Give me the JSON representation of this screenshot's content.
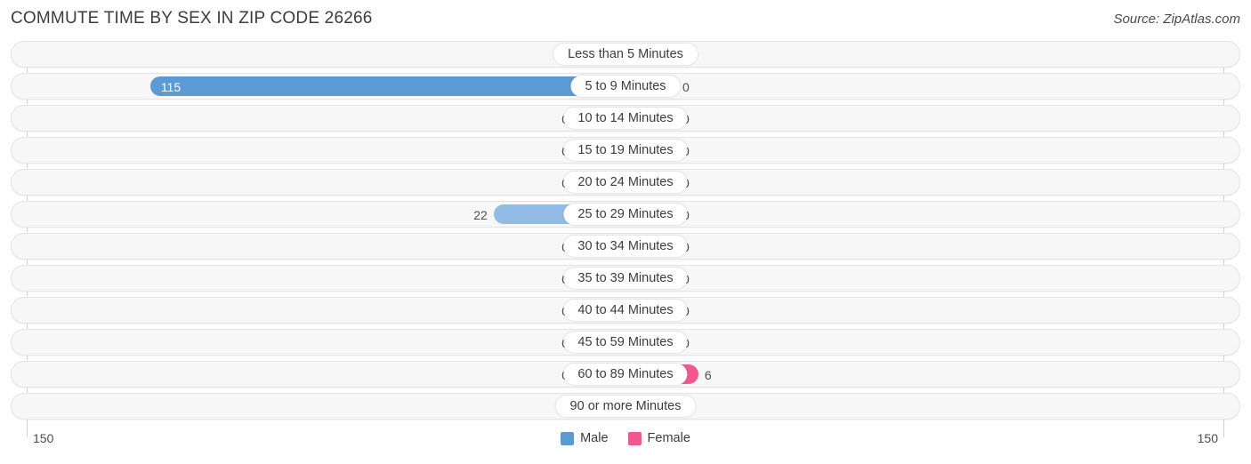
{
  "header": {
    "title": "COMMUTE TIME BY SEX IN ZIP CODE 26266",
    "source": "Source: ZipAtlas.com"
  },
  "axis": {
    "left_tick": "150",
    "right_tick": "150",
    "max": 150
  },
  "legend": {
    "male_label": "Male",
    "female_label": "Female",
    "male_color": "#5b9bd5",
    "female_color": "#f4568f"
  },
  "colors": {
    "male_zero": "#a8c8ea",
    "male_mid": "#92bce6",
    "male_strong": "#5b9bd5",
    "female_zero": "#f5a9c0",
    "female_strong": "#f4568f",
    "track": "#f7f7f7",
    "track_border": "#e4e4e4"
  },
  "chart_data": {
    "type": "bar",
    "title": "COMMUTE TIME BY SEX IN ZIP CODE 26266",
    "subtitle": "Source: ZipAtlas.com",
    "orientation": "horizontal-diverging",
    "xlabel": "",
    "ylabel": "",
    "xlim": [
      150,
      150
    ],
    "grid": false,
    "legend_position": "bottom-center",
    "categories": [
      "Less than 5 Minutes",
      "5 to 9 Minutes",
      "10 to 14 Minutes",
      "15 to 19 Minutes",
      "20 to 24 Minutes",
      "25 to 29 Minutes",
      "30 to 34 Minutes",
      "35 to 39 Minutes",
      "40 to 44 Minutes",
      "45 to 59 Minutes",
      "60 to 89 Minutes",
      "90 or more Minutes"
    ],
    "series": [
      {
        "name": "Male",
        "values": [
          0,
          115,
          0,
          0,
          0,
          22,
          0,
          0,
          0,
          0,
          0,
          0
        ]
      },
      {
        "name": "Female",
        "values": [
          0,
          0,
          0,
          0,
          0,
          0,
          0,
          0,
          0,
          0,
          6,
          0
        ]
      }
    ]
  },
  "rows": [
    {
      "label": "Less than 5 Minutes",
      "male": "0",
      "female": "0",
      "male_inside": false,
      "female_inside": false
    },
    {
      "label": "5 to 9 Minutes",
      "male": "115",
      "female": "0",
      "male_inside": true,
      "female_inside": false
    },
    {
      "label": "10 to 14 Minutes",
      "male": "0",
      "female": "0",
      "male_inside": false,
      "female_inside": false
    },
    {
      "label": "15 to 19 Minutes",
      "male": "0",
      "female": "0",
      "male_inside": false,
      "female_inside": false
    },
    {
      "label": "20 to 24 Minutes",
      "male": "0",
      "female": "0",
      "male_inside": false,
      "female_inside": false
    },
    {
      "label": "25 to 29 Minutes",
      "male": "22",
      "female": "0",
      "male_inside": false,
      "female_inside": false
    },
    {
      "label": "30 to 34 Minutes",
      "male": "0",
      "female": "0",
      "male_inside": false,
      "female_inside": false
    },
    {
      "label": "35 to 39 Minutes",
      "male": "0",
      "female": "0",
      "male_inside": false,
      "female_inside": false
    },
    {
      "label": "40 to 44 Minutes",
      "male": "0",
      "female": "0",
      "male_inside": false,
      "female_inside": false
    },
    {
      "label": "45 to 59 Minutes",
      "male": "0",
      "female": "0",
      "male_inside": false,
      "female_inside": false
    },
    {
      "label": "60 to 89 Minutes",
      "male": "0",
      "female": "6",
      "male_inside": false,
      "female_inside": false
    },
    {
      "label": "90 or more Minutes",
      "male": "0",
      "female": "0",
      "male_inside": false,
      "female_inside": false
    }
  ]
}
